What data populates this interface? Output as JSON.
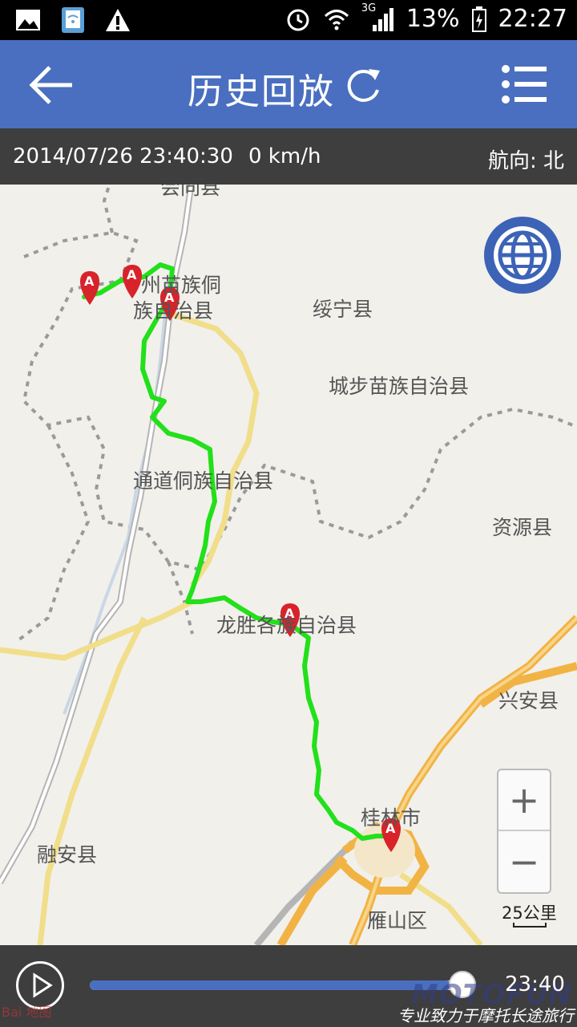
{
  "status": {
    "battery": "13%",
    "time": "22:27",
    "signal_label": "3G"
  },
  "appbar": {
    "title": "历史回放"
  },
  "info": {
    "datetime": "2014/07/26 23:40:30",
    "speed": "0 km/h",
    "heading": "航向: 北"
  },
  "map": {
    "places": [
      "会同县",
      "州苗族侗",
      "族自治县",
      "绥宁县",
      "城步苗族自治县",
      "通道侗族自治县",
      "资源县",
      "龙胜各族自治县",
      "兴安县",
      "桂林市",
      "融安县",
      "雁山区"
    ],
    "route_color": "#22e01a",
    "marker_color": "#d8232a",
    "scale_label": "25公里",
    "zoom_in": "+",
    "zoom_out": "−"
  },
  "player": {
    "progress": 0.94,
    "time_label": "23:40",
    "watermark": "MOTOFUN",
    "watermark_sub": "专业致力于摩托长途旅行",
    "map_credit": "Bai 地图"
  }
}
